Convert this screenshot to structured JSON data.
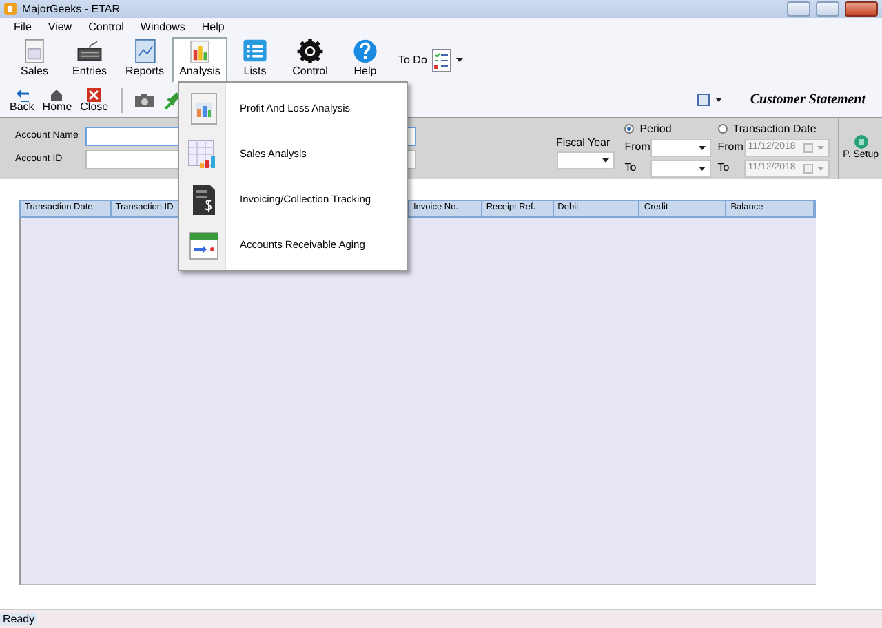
{
  "window": {
    "title": "MajorGeeks - ETAR"
  },
  "menu_bar": [
    "File",
    "View",
    "Control",
    "Windows",
    "Help"
  ],
  "toolbar": [
    {
      "label": "Sales",
      "selected": false
    },
    {
      "label": "Entries",
      "selected": false
    },
    {
      "label": "Reports",
      "selected": false
    },
    {
      "label": "Analysis",
      "selected": true
    },
    {
      "label": "Lists",
      "selected": false
    },
    {
      "label": "Control",
      "selected": false
    },
    {
      "label": "Help",
      "selected": false
    }
  ],
  "todo": {
    "label": "To Do"
  },
  "nav_toolbar": [
    {
      "label": "Back"
    },
    {
      "label": "Home"
    },
    {
      "label": "Close"
    }
  ],
  "report_title": "Customer Statement",
  "filters": {
    "account_name": {
      "label": "Account Name"
    },
    "account_id": {
      "label": "Account ID"
    },
    "fiscal_year": {
      "label": "Fiscal Year"
    },
    "range_options": [
      {
        "label": "Period",
        "selected": true,
        "fields": [
          {
            "label": "From",
            "disabled": false
          },
          {
            "label": "To",
            "disabled": false
          }
        ]
      },
      {
        "label": "Transaction Date",
        "selected": false,
        "fields": [
          {
            "label": "From",
            "value": "11/12/2018",
            "disabled": true
          },
          {
            "label": "To",
            "value": "11/12/2018",
            "disabled": true
          }
        ]
      }
    ]
  },
  "print_setup": {
    "label": "P. Setup"
  },
  "table": {
    "columns": [
      "Transaction Date",
      "Transaction ID",
      "Invoice No.",
      "Receipt Ref.",
      "Debit",
      "Credit",
      "Balance"
    ]
  },
  "analysis_menu": [
    {
      "label": "Profit And Loss Analysis"
    },
    {
      "label": "Sales Analysis"
    },
    {
      "label": "Invoicing/Collection Tracking"
    },
    {
      "label": "Accounts Receivable Aging"
    }
  ],
  "status_bar": "Ready"
}
